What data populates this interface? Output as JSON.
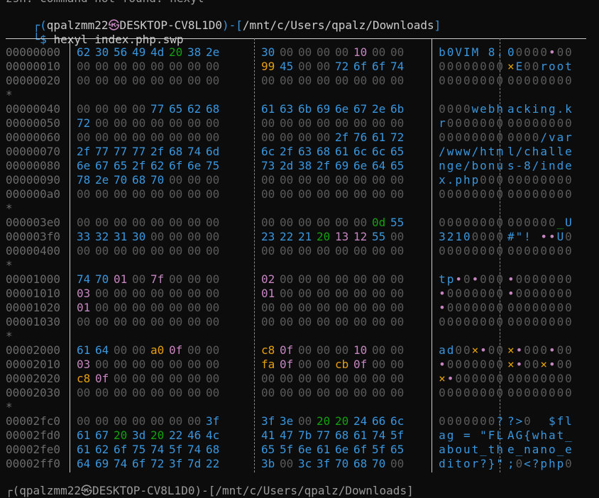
{
  "terminal": {
    "previous_output": "zsh: command not found: hexyl",
    "prompt": {
      "open": "┌(",
      "user": "qpalzmm22",
      "at_symbol": "㉿",
      "host": "DESKTOP-CV8L1D0",
      "mid": ")-[",
      "path": "/mnt/c/Users/qpalz/Downloads",
      "close": "]"
    },
    "command_prefix": "└$ ",
    "command": "hexyl index.php.swp",
    "next_prompt_partial": "┌(qpalzmm22㉿DESKTOP-CV8L1D0)-[/mnt/c/Users/qpalz/Downloads]"
  },
  "colors": {
    "background": "#0c0c0c",
    "null_byte": "#5a5a5a",
    "printable": "#3a96dd",
    "whitespace": "#13a10e",
    "control": "#c586c0",
    "non_ascii": "#e5a00d",
    "offset": "#6b6b6b"
  },
  "hexdump": [
    {
      "offset": "00000000",
      "hex": [
        "62",
        "30",
        "56",
        "49",
        "4d",
        "20",
        "38",
        "2e",
        "30",
        "00",
        "00",
        "00",
        "00",
        "10",
        "00",
        "00"
      ],
      "ascii": [
        "b",
        "0",
        "V",
        "I",
        "M",
        " ",
        "8",
        ".",
        "0",
        "0",
        "0",
        "0",
        "0",
        "•",
        "0",
        "0"
      ]
    },
    {
      "offset": "00000010",
      "hex": [
        "00",
        "00",
        "00",
        "00",
        "00",
        "00",
        "00",
        "00",
        "99",
        "45",
        "00",
        "00",
        "72",
        "6f",
        "6f",
        "74"
      ],
      "ascii": [
        "0",
        "0",
        "0",
        "0",
        "0",
        "0",
        "0",
        "0",
        "×",
        "E",
        "0",
        "0",
        "r",
        "o",
        "o",
        "t"
      ]
    },
    {
      "offset": "00000020",
      "hex": [
        "00",
        "00",
        "00",
        "00",
        "00",
        "00",
        "00",
        "00",
        "00",
        "00",
        "00",
        "00",
        "00",
        "00",
        "00",
        "00"
      ],
      "ascii": [
        "0",
        "0",
        "0",
        "0",
        "0",
        "0",
        "0",
        "0",
        "0",
        "0",
        "0",
        "0",
        "0",
        "0",
        "0",
        "0"
      ]
    },
    {
      "star": "*"
    },
    {
      "offset": "00000040",
      "hex": [
        "00",
        "00",
        "00",
        "00",
        "77",
        "65",
        "62",
        "68",
        "61",
        "63",
        "6b",
        "69",
        "6e",
        "67",
        "2e",
        "6b"
      ],
      "ascii": [
        "0",
        "0",
        "0",
        "0",
        "w",
        "e",
        "b",
        "h",
        "a",
        "c",
        "k",
        "i",
        "n",
        "g",
        ".",
        "k"
      ]
    },
    {
      "offset": "00000050",
      "hex": [
        "72",
        "00",
        "00",
        "00",
        "00",
        "00",
        "00",
        "00",
        "00",
        "00",
        "00",
        "00",
        "00",
        "00",
        "00",
        "00"
      ],
      "ascii": [
        "r",
        "0",
        "0",
        "0",
        "0",
        "0",
        "0",
        "0",
        "0",
        "0",
        "0",
        "0",
        "0",
        "0",
        "0",
        "0"
      ]
    },
    {
      "offset": "00000060",
      "hex": [
        "00",
        "00",
        "00",
        "00",
        "00",
        "00",
        "00",
        "00",
        "00",
        "00",
        "00",
        "00",
        "2f",
        "76",
        "61",
        "72"
      ],
      "ascii": [
        "0",
        "0",
        "0",
        "0",
        "0",
        "0",
        "0",
        "0",
        "0",
        "0",
        "0",
        "0",
        "/",
        "v",
        "a",
        "r"
      ]
    },
    {
      "offset": "00000070",
      "hex": [
        "2f",
        "77",
        "77",
        "77",
        "2f",
        "68",
        "74",
        "6d",
        "6c",
        "2f",
        "63",
        "68",
        "61",
        "6c",
        "6c",
        "65"
      ],
      "ascii": [
        "/",
        "w",
        "w",
        "w",
        "/",
        "h",
        "t",
        "m",
        "l",
        "/",
        "c",
        "h",
        "a",
        "l",
        "l",
        "e"
      ]
    },
    {
      "offset": "00000080",
      "hex": [
        "6e",
        "67",
        "65",
        "2f",
        "62",
        "6f",
        "6e",
        "75",
        "73",
        "2d",
        "38",
        "2f",
        "69",
        "6e",
        "64",
        "65"
      ],
      "ascii": [
        "n",
        "g",
        "e",
        "/",
        "b",
        "o",
        "n",
        "u",
        "s",
        "-",
        "8",
        "/",
        "i",
        "n",
        "d",
        "e"
      ]
    },
    {
      "offset": "00000090",
      "hex": [
        "78",
        "2e",
        "70",
        "68",
        "70",
        "00",
        "00",
        "00",
        "00",
        "00",
        "00",
        "00",
        "00",
        "00",
        "00",
        "00"
      ],
      "ascii": [
        "x",
        ".",
        "p",
        "h",
        "p",
        "0",
        "0",
        "0",
        "0",
        "0",
        "0",
        "0",
        "0",
        "0",
        "0",
        "0"
      ]
    },
    {
      "offset": "000000a0",
      "hex": [
        "00",
        "00",
        "00",
        "00",
        "00",
        "00",
        "00",
        "00",
        "00",
        "00",
        "00",
        "00",
        "00",
        "00",
        "00",
        "00"
      ],
      "ascii": [
        "0",
        "0",
        "0",
        "0",
        "0",
        "0",
        "0",
        "0",
        "0",
        "0",
        "0",
        "0",
        "0",
        "0",
        "0",
        "0"
      ]
    },
    {
      "star": "*"
    },
    {
      "offset": "000003e0",
      "hex": [
        "00",
        "00",
        "00",
        "00",
        "00",
        "00",
        "00",
        "00",
        "00",
        "00",
        "00",
        "00",
        "00",
        "00",
        "0d",
        "55"
      ],
      "ascii": [
        "0",
        "0",
        "0",
        "0",
        "0",
        "0",
        "0",
        "0",
        "0",
        "0",
        "0",
        "0",
        "0",
        "0",
        "_",
        "U"
      ]
    },
    {
      "offset": "000003f0",
      "hex": [
        "33",
        "32",
        "31",
        "30",
        "00",
        "00",
        "00",
        "00",
        "23",
        "22",
        "21",
        "20",
        "13",
        "12",
        "55",
        "00"
      ],
      "ascii": [
        "3",
        "2",
        "1",
        "0",
        "0",
        "0",
        "0",
        "0",
        "#",
        "\"",
        "!",
        " ",
        "•",
        "•",
        "U",
        "0"
      ]
    },
    {
      "offset": "00000400",
      "hex": [
        "00",
        "00",
        "00",
        "00",
        "00",
        "00",
        "00",
        "00",
        "00",
        "00",
        "00",
        "00",
        "00",
        "00",
        "00",
        "00"
      ],
      "ascii": [
        "0",
        "0",
        "0",
        "0",
        "0",
        "0",
        "0",
        "0",
        "0",
        "0",
        "0",
        "0",
        "0",
        "0",
        "0",
        "0"
      ]
    },
    {
      "star": "*"
    },
    {
      "offset": "00001000",
      "hex": [
        "74",
        "70",
        "01",
        "00",
        "7f",
        "00",
        "00",
        "00",
        "02",
        "00",
        "00",
        "00",
        "00",
        "00",
        "00",
        "00"
      ],
      "ascii": [
        "t",
        "p",
        "•",
        "0",
        "•",
        "0",
        "0",
        "0",
        "•",
        "0",
        "0",
        "0",
        "0",
        "0",
        "0",
        "0"
      ]
    },
    {
      "offset": "00001010",
      "hex": [
        "03",
        "00",
        "00",
        "00",
        "00",
        "00",
        "00",
        "00",
        "01",
        "00",
        "00",
        "00",
        "00",
        "00",
        "00",
        "00"
      ],
      "ascii": [
        "•",
        "0",
        "0",
        "0",
        "0",
        "0",
        "0",
        "0",
        "•",
        "0",
        "0",
        "0",
        "0",
        "0",
        "0",
        "0"
      ]
    },
    {
      "offset": "00001020",
      "hex": [
        "01",
        "00",
        "00",
        "00",
        "00",
        "00",
        "00",
        "00",
        "00",
        "00",
        "00",
        "00",
        "00",
        "00",
        "00",
        "00"
      ],
      "ascii": [
        "•",
        "0",
        "0",
        "0",
        "0",
        "0",
        "0",
        "0",
        "0",
        "0",
        "0",
        "0",
        "0",
        "0",
        "0",
        "0"
      ]
    },
    {
      "offset": "00001030",
      "hex": [
        "00",
        "00",
        "00",
        "00",
        "00",
        "00",
        "00",
        "00",
        "00",
        "00",
        "00",
        "00",
        "00",
        "00",
        "00",
        "00"
      ],
      "ascii": [
        "0",
        "0",
        "0",
        "0",
        "0",
        "0",
        "0",
        "0",
        "0",
        "0",
        "0",
        "0",
        "0",
        "0",
        "0",
        "0"
      ]
    },
    {
      "star": "*"
    },
    {
      "offset": "00002000",
      "hex": [
        "61",
        "64",
        "00",
        "00",
        "a0",
        "0f",
        "00",
        "00",
        "c8",
        "0f",
        "00",
        "00",
        "00",
        "10",
        "00",
        "00"
      ],
      "ascii": [
        "a",
        "d",
        "0",
        "0",
        "×",
        "•",
        "0",
        "0",
        "×",
        "•",
        "0",
        "0",
        "0",
        "•",
        "0",
        "0"
      ]
    },
    {
      "offset": "00002010",
      "hex": [
        "03",
        "00",
        "00",
        "00",
        "00",
        "00",
        "00",
        "00",
        "fa",
        "0f",
        "00",
        "00",
        "cb",
        "0f",
        "00",
        "00"
      ],
      "ascii": [
        "•",
        "0",
        "0",
        "0",
        "0",
        "0",
        "0",
        "0",
        "×",
        "•",
        "0",
        "0",
        "×",
        "•",
        "0",
        "0"
      ]
    },
    {
      "offset": "00002020",
      "hex": [
        "c8",
        "0f",
        "00",
        "00",
        "00",
        "00",
        "00",
        "00",
        "00",
        "00",
        "00",
        "00",
        "00",
        "00",
        "00",
        "00"
      ],
      "ascii": [
        "×",
        "•",
        "0",
        "0",
        "0",
        "0",
        "0",
        "0",
        "0",
        "0",
        "0",
        "0",
        "0",
        "0",
        "0",
        "0"
      ]
    },
    {
      "offset": "00002030",
      "hex": [
        "00",
        "00",
        "00",
        "00",
        "00",
        "00",
        "00",
        "00",
        "00",
        "00",
        "00",
        "00",
        "00",
        "00",
        "00",
        "00"
      ],
      "ascii": [
        "0",
        "0",
        "0",
        "0",
        "0",
        "0",
        "0",
        "0",
        "0",
        "0",
        "0",
        "0",
        "0",
        "0",
        "0",
        "0"
      ]
    },
    {
      "star": "*"
    },
    {
      "offset": "00002fc0",
      "hex": [
        "00",
        "00",
        "00",
        "00",
        "00",
        "00",
        "00",
        "3f",
        "3f",
        "3e",
        "00",
        "20",
        "20",
        "24",
        "66",
        "6c"
      ],
      "ascii": [
        "0",
        "0",
        "0",
        "0",
        "0",
        "0",
        "0",
        "?",
        "?",
        ">",
        "0",
        " ",
        " ",
        "$",
        "f",
        "l"
      ]
    },
    {
      "offset": "00002fd0",
      "hex": [
        "61",
        "67",
        "20",
        "3d",
        "20",
        "22",
        "46",
        "4c",
        "41",
        "47",
        "7b",
        "77",
        "68",
        "61",
        "74",
        "5f"
      ],
      "ascii": [
        "a",
        "g",
        " ",
        "=",
        " ",
        "\"",
        "F",
        "L",
        "A",
        "G",
        "{",
        "w",
        "h",
        "a",
        "t",
        "_"
      ]
    },
    {
      "offset": "00002fe0",
      "hex": [
        "61",
        "62",
        "6f",
        "75",
        "74",
        "5f",
        "74",
        "68",
        "65",
        "5f",
        "6e",
        "61",
        "6e",
        "6f",
        "5f",
        "65"
      ],
      "ascii": [
        "a",
        "b",
        "o",
        "u",
        "t",
        "_",
        "t",
        "h",
        "e",
        "_",
        "n",
        "a",
        "n",
        "o",
        "_",
        "e"
      ]
    },
    {
      "offset": "00002ff0",
      "hex": [
        "64",
        "69",
        "74",
        "6f",
        "72",
        "3f",
        "7d",
        "22",
        "3b",
        "00",
        "3c",
        "3f",
        "70",
        "68",
        "70",
        "00"
      ],
      "ascii": [
        "d",
        "i",
        "t",
        "o",
        "r",
        "?",
        "}",
        "\"",
        ";",
        "0",
        "<",
        "?",
        "p",
        "h",
        "p",
        "0"
      ]
    }
  ]
}
